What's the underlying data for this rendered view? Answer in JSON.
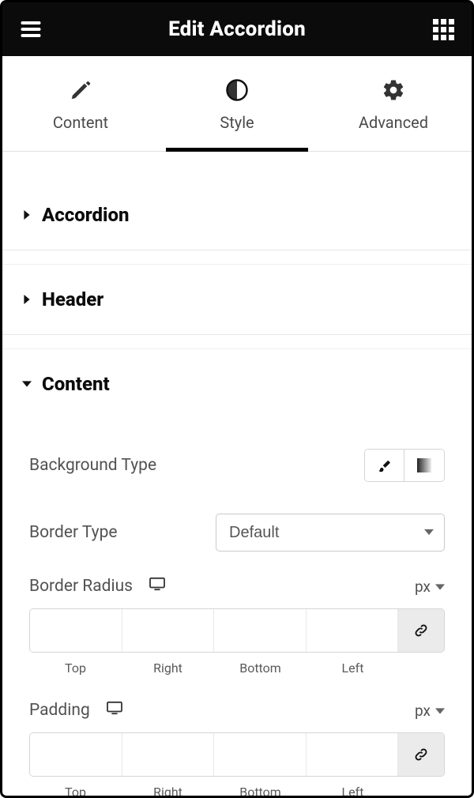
{
  "header": {
    "title": "Edit Accordion"
  },
  "tabs": {
    "content": "Content",
    "style": "Style",
    "advanced": "Advanced",
    "active": "style"
  },
  "sections": {
    "accordion": {
      "title": "Accordion"
    },
    "headerSec": {
      "title": "Header"
    },
    "contentSec": {
      "title": "Content"
    }
  },
  "controls": {
    "backgroundType": {
      "label": "Background Type"
    },
    "borderType": {
      "label": "Border Type",
      "value": "Default"
    },
    "borderRadius": {
      "label": "Border Radius",
      "unit": "px",
      "sides": {
        "top": "Top",
        "right": "Right",
        "bottom": "Bottom",
        "left": "Left"
      }
    },
    "padding": {
      "label": "Padding",
      "unit": "px",
      "sides": {
        "top": "Top",
        "right": "Right",
        "bottom": "Bottom",
        "left": "Left"
      }
    }
  }
}
